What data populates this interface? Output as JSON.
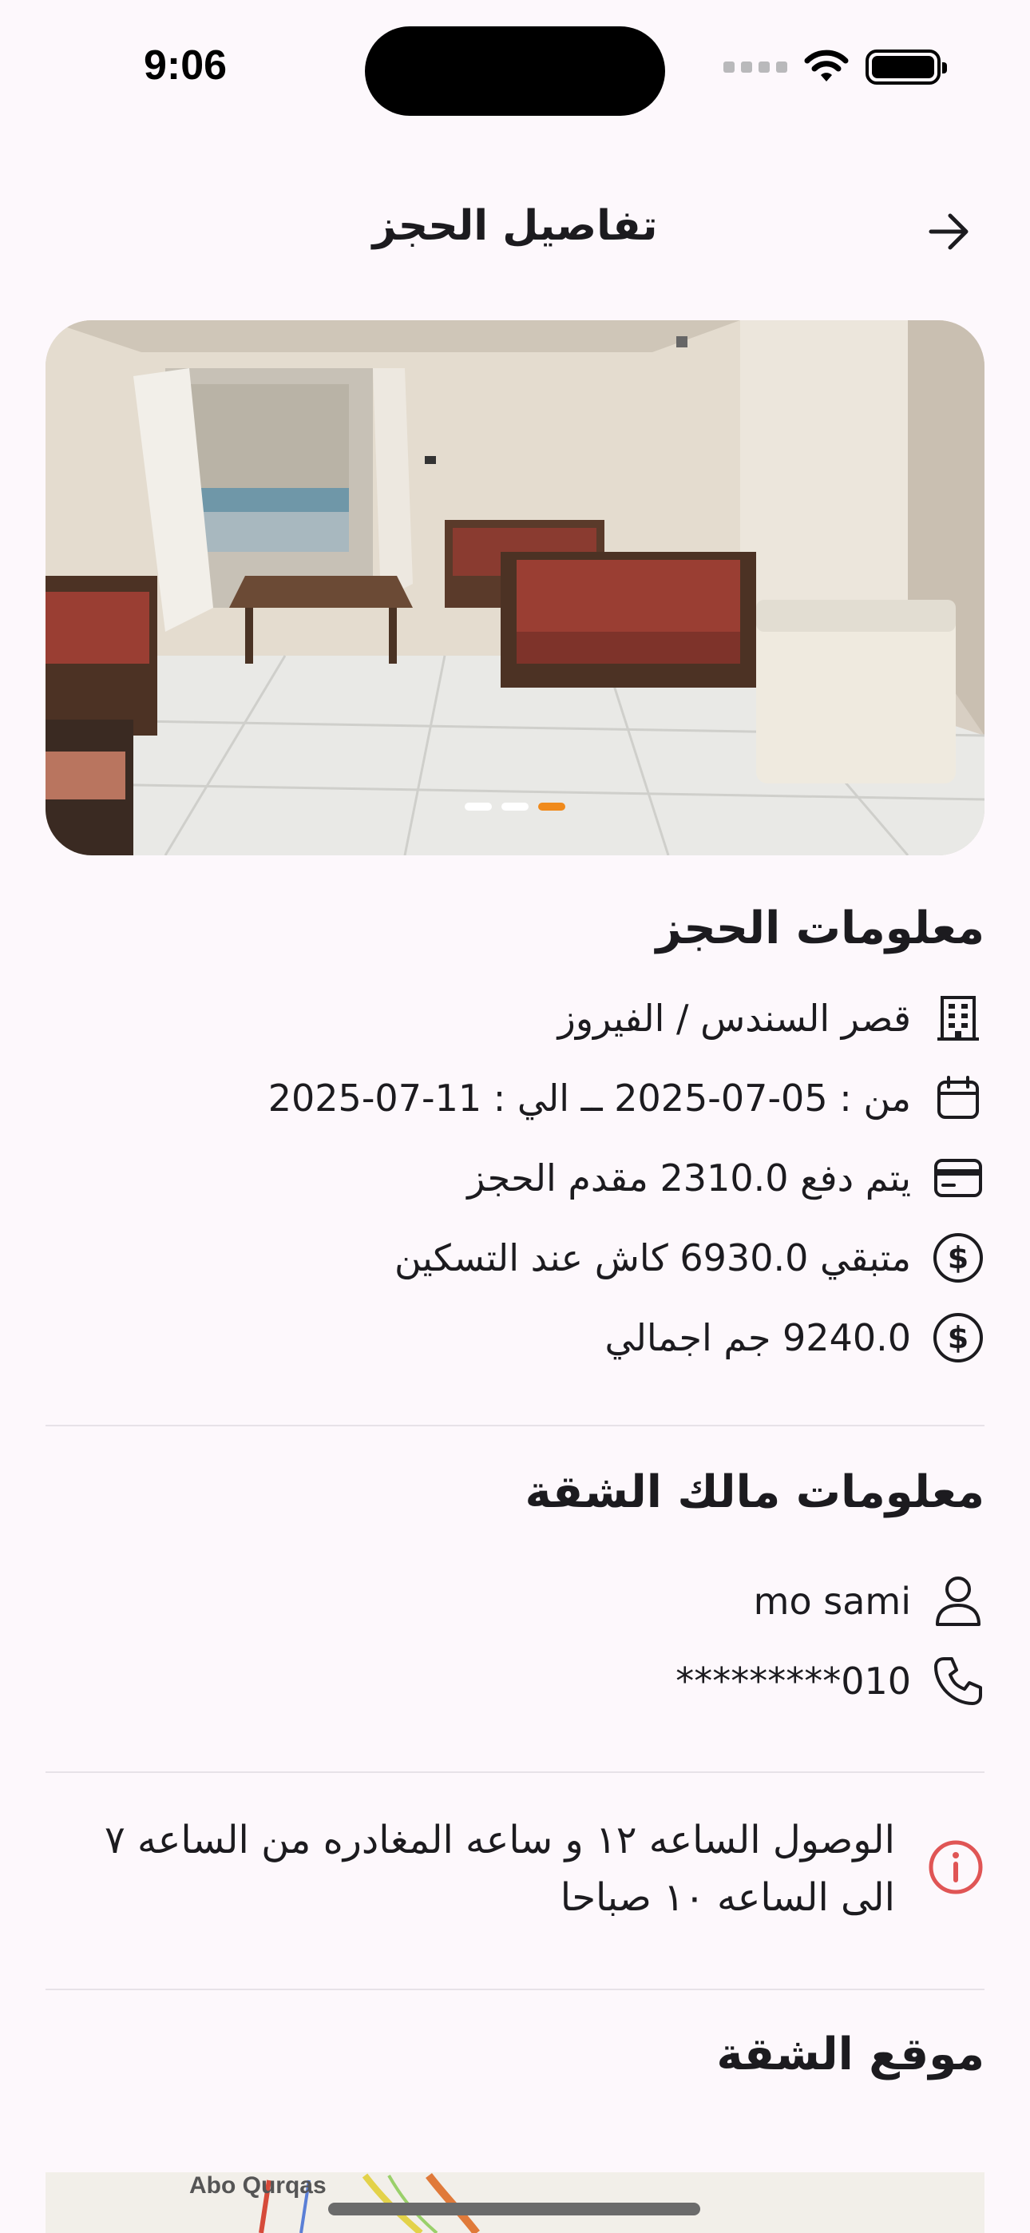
{
  "status_bar": {
    "time": "9:06"
  },
  "header": {
    "title": "تفاصيل الحجز"
  },
  "gallery": {
    "dots_count": 3,
    "active_index": 2
  },
  "booking": {
    "section_title": "معلومات الحجز",
    "property": "قصر السندس / الفيروز",
    "dates": "من : 05-07-2025 ــ الي : 11-07-2025",
    "paid": "يتم دفع 2310.0 مقدم الحجز",
    "remaining": "متبقي 6930.0 كاش عند التسكين",
    "total": "9240.0 جم اجمالي"
  },
  "owner": {
    "section_title": "معلومات مالك الشقة",
    "name": "mo sami",
    "phone": "010*********"
  },
  "note": {
    "text": "الوصول الساعه ١٢ و ساعه المغادره من الساعه ٧ الى الساعه ١٠ صباحا"
  },
  "location": {
    "section_title": "موقع الشقة",
    "map_label": "Abo Qurqas"
  },
  "colors": {
    "accent": "#f08a1c",
    "info": "#e05555",
    "background": "#fdf8fc"
  }
}
